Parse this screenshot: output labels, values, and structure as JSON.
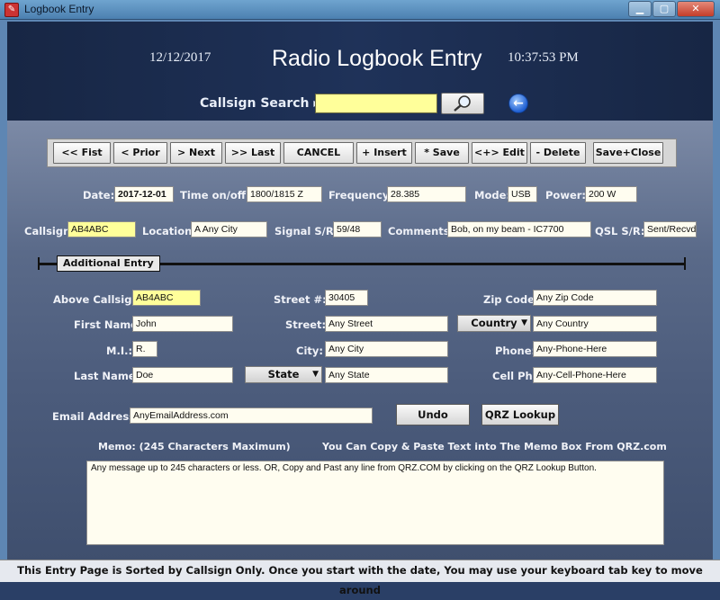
{
  "window": {
    "title": "Logbook Entry",
    "icon": "app-logbook-icon",
    "controls": [
      "minimize",
      "maximize",
      "close"
    ]
  },
  "header": {
    "date": "12/12/2017",
    "title": "Radio Logbook Entry",
    "time": "10:37:53 PM",
    "search_label": "Callsign Search ▸",
    "search_value": ""
  },
  "toolbar": {
    "first": "<<  Fist",
    "prior": "<  Prior",
    "next": ">  Next",
    "last": ">>  Last",
    "cancel": "CANCEL",
    "insert": "+  Insert",
    "save": "*  Save",
    "edit": "<+>  Edit",
    "delete": "-  Delete",
    "save_close": "Save+Close"
  },
  "entry": {
    "date_label": "Date:",
    "date_value": "2017-12-01",
    "time_label": "Time on/off:",
    "time_value": "1800/1815 Z",
    "frequency_label": "Frequency:",
    "frequency_value": "28.385",
    "mode_label": "Mode:",
    "mode_value": "USB",
    "power_label": "Power:",
    "power_value": "200 W",
    "callsign_label": "Callsign:",
    "callsign_value": "AB4ABC",
    "location_label": "Location:",
    "location_value": "A Any City",
    "signal_label": "Signal S/R:",
    "signal_value": "59/48",
    "comments_label": "Comments:",
    "comments_value": "Bob,  on my beam - IC7700",
    "qsl_label": "QSL S/R:",
    "qsl_value": "Sent/Recvd"
  },
  "additional": {
    "section_title": "Additional Entry",
    "above_callsign_label": "Above Callsign:",
    "above_callsign_value": "AB4ABC",
    "first_name_label": "First Name:",
    "first_name_value": "John",
    "mi_label": "M.I.:",
    "mi_value": "R.",
    "last_name_label": "Last Name:",
    "last_name_value": "Doe",
    "street_num_label": "Street #:",
    "street_num_value": "30405",
    "street_label": "Street:",
    "street_value": "Any Street",
    "city_label": "City:",
    "city_value": "Any City",
    "state_select": "State",
    "state_value": "Any State",
    "country_select": "Country",
    "country_value": "Any Country",
    "zip_label": "Zip Code:",
    "zip_value": "Any Zip Code",
    "phone_label": "Phone:",
    "phone_value": "Any-Phone-Here",
    "cell_label": "Cell Ph:",
    "cell_value": "Any-Cell-Phone-Here",
    "email_label": "Email Address:",
    "email_value": "AnyEmailAddress.com",
    "undo": "Undo",
    "qrz_lookup": "QRZ Lookup"
  },
  "memo": {
    "label": "Memo:  (245 Characters Maximum)",
    "hint": "You Can Copy & Paste Text into The Memo Box From QRZ.com",
    "value": "Any message up to 245 characters or less.   OR, Copy and Past any line from QRZ.COM by clicking on the QRZ Lookup Button."
  },
  "status": {
    "text": "This Entry Page is Sorted by Callsign Only.   Once you start with the date, You may use your keyboard tab key to move around"
  }
}
